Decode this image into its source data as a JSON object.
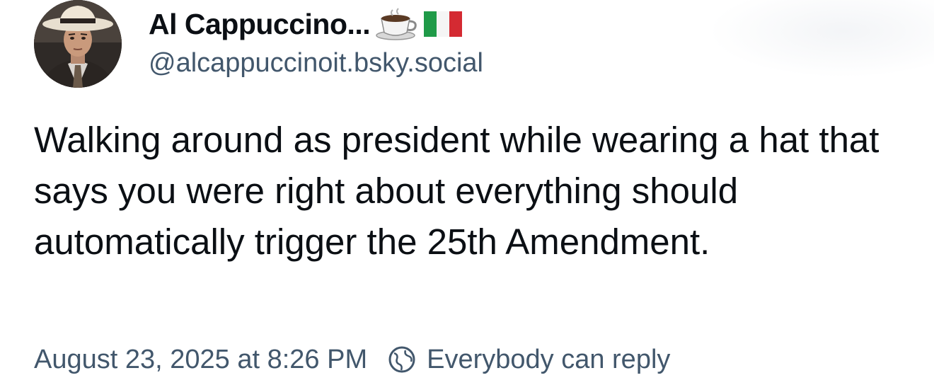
{
  "author": {
    "display_name": "Al Cappuccino...",
    "handle": "@alcappuccinoit.bsky.social",
    "avatar_icon": "avatar-man-in-hat",
    "name_emojis": [
      "coffee-cup-emoji",
      "italy-flag-emoji"
    ]
  },
  "post": {
    "text": "Walking around as president while wearing a hat that says you were right about everything should automatically trigger the 25th Amendment."
  },
  "meta": {
    "timestamp": "August 23, 2025 at 8:26 PM",
    "reply_setting_label": "Everybody can reply",
    "reply_setting_icon": "globe-icon"
  },
  "colors": {
    "text_primary": "#0b0f14",
    "text_secondary": "#42576c",
    "background": "#ffffff"
  }
}
